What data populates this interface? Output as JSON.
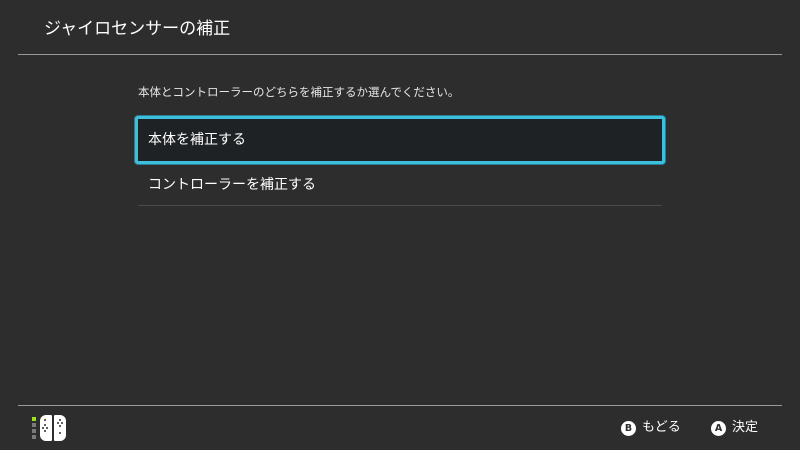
{
  "header": {
    "title": "ジャイロセンサーの補正"
  },
  "main": {
    "instruction": "本体とコントローラーのどちらを補正するか選んでください。",
    "options": [
      {
        "label": "本体を補正する",
        "selected": true
      },
      {
        "label": "コントローラーを補正する",
        "selected": false
      }
    ]
  },
  "footer": {
    "controller_indicator": {
      "icon": "joycon-pair-icon",
      "active_player_led": 1
    },
    "actions": [
      {
        "button": "B",
        "label": "もどる"
      },
      {
        "button": "A",
        "label": "決定"
      }
    ]
  },
  "colors": {
    "background": "#2d2d2d",
    "selection_border": "#3ec0dc",
    "selected_fill": "#1f2225",
    "player_led_on": "#9be021",
    "divider": "#9a9a9a"
  }
}
